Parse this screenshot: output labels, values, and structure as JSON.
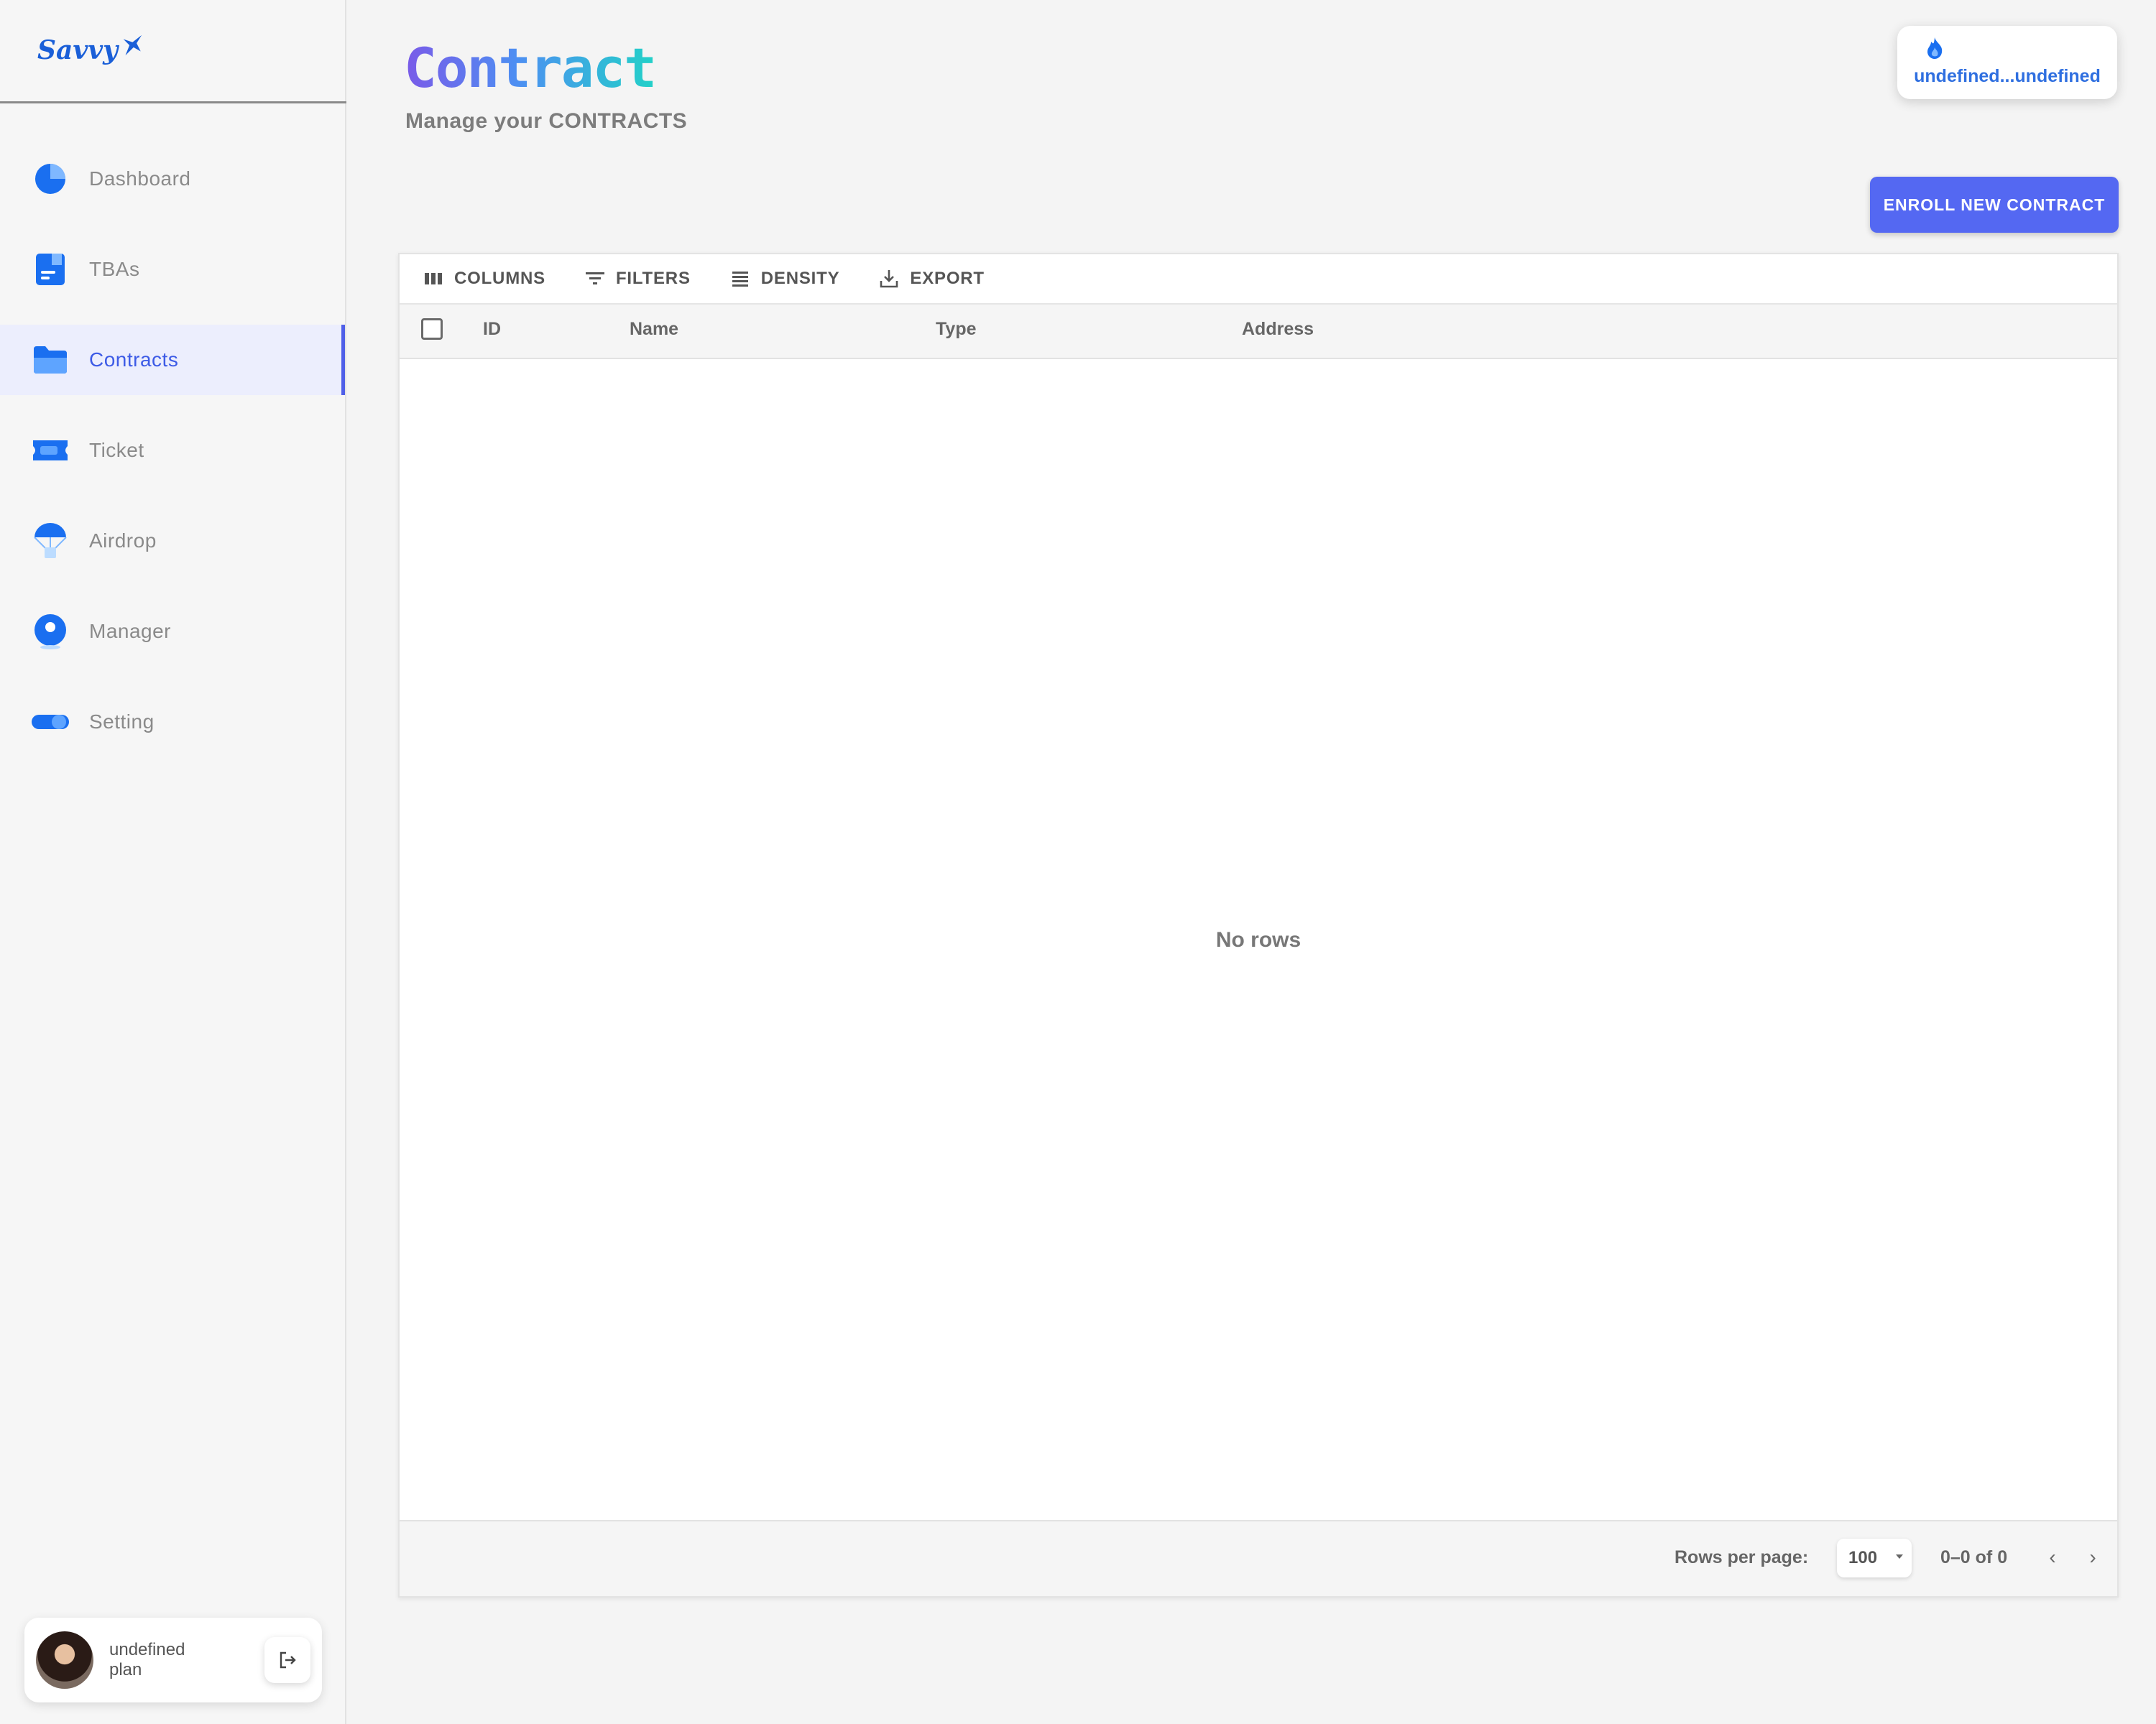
{
  "app": {
    "logo_text": "Savvy"
  },
  "sidebar": {
    "items": [
      {
        "label": "Dashboard",
        "icon": "pie-chart-icon",
        "active": false
      },
      {
        "label": "TBAs",
        "icon": "document-icon",
        "active": false
      },
      {
        "label": "Contracts",
        "icon": "folder-icon",
        "active": true
      },
      {
        "label": "Ticket",
        "icon": "ticket-icon",
        "active": false
      },
      {
        "label": "Airdrop",
        "icon": "parachute-icon",
        "active": false
      },
      {
        "label": "Manager",
        "icon": "user-circle-icon",
        "active": false
      },
      {
        "label": "Setting",
        "icon": "toggle-icon",
        "active": false
      }
    ],
    "user": {
      "name": "undefined",
      "plan": "plan"
    }
  },
  "header": {
    "title": "Contract",
    "subtitle": "Manage your CONTRACTS",
    "wallet": "undefined...undefined",
    "enroll_label": "ENROLL NEW CONTRACT"
  },
  "grid": {
    "toolbar": [
      "COLUMNS",
      "FILTERS",
      "DENSITY",
      "EXPORT"
    ],
    "columns": [
      "ID",
      "Name",
      "Type",
      "Address"
    ],
    "empty_text": "No rows",
    "footer": {
      "rows_per_page_label": "Rows per page:",
      "rows_per_page_value": "100",
      "range": "0–0 of 0"
    }
  },
  "colors": {
    "accent": "#5468f2",
    "active_nav": "#3d5be6",
    "icon_blue": "#1a6ff0",
    "title_gradient": [
      "#7a5ae8",
      "#4d8ff2",
      "#22d1c8"
    ]
  }
}
